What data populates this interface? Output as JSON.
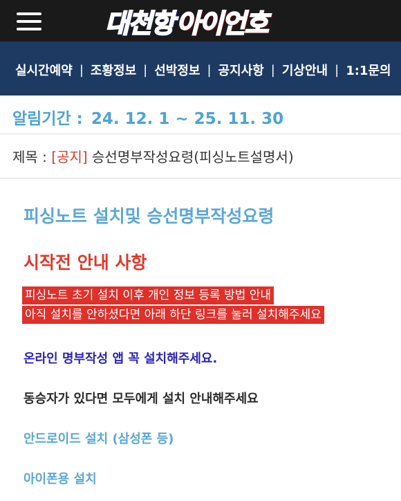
{
  "header": {
    "menu_icon": "hamburger-icon",
    "logo_part1": "대천항",
    "logo_part2": "아이언호",
    "colors": {
      "bar": "#1a1a1a",
      "logo_blue": "#1e3fa8",
      "logo_red": "#e0282a"
    }
  },
  "nav": {
    "items": [
      "실시간예약",
      "조황정보",
      "선박정보",
      "공지사항",
      "기상안내",
      "1:1문의"
    ],
    "separator": "|",
    "background": "#1d3a63"
  },
  "notice": {
    "period_label": "알림기간 :",
    "period_value": "24. 12. 1 ~ 25. 11. 30",
    "subject_label": "제목 :",
    "subject_tag": "[공지]",
    "subject_title": "승선명부작성요령(피싱노트설명서)"
  },
  "content": {
    "heading": "피싱노트 설치및 승선명부작성요령",
    "subheading": "시작전 안내 사항",
    "highlight_line1": "피싱노트 초기 설치 이후 개인 정보 등록 방법 안내",
    "highlight_line2": "아직 설치를 안하셨다면 아래 하단 링크를 눌러 설치해주세요",
    "blue_line": "온라인 명부작성 앱 꼭 설치해주세요.",
    "dark_line": "동승자가 있다면 모두에게 설치 안내해주세요",
    "android_link": "안드로이드 설치 (삼성폰 등)",
    "iphone_link": "아이폰용 설치"
  }
}
